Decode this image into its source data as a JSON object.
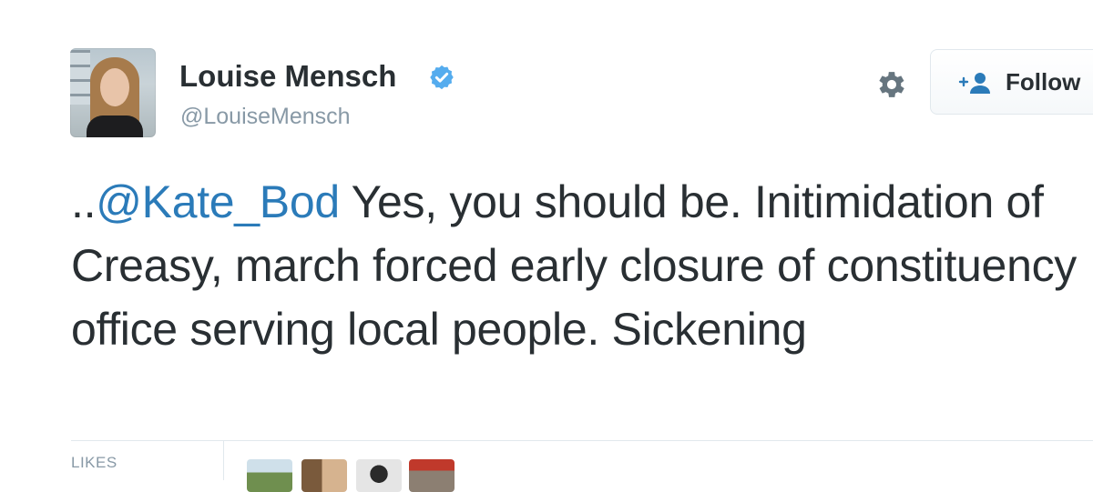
{
  "user": {
    "name": "Louise Mensch",
    "handle": "@LouiseMensch",
    "verified": true,
    "avatar_icon": "profile-photo"
  },
  "actions": {
    "settings_icon": "gear-icon",
    "follow_label": "Follow",
    "follow_icon": "add-person-icon"
  },
  "tweet": {
    "prefix": "..",
    "mention": "@Kate_Bod",
    "text": " Yes, you should be. Initimidation of Creasy, march forced early closure of constituency office serving local people. Sickening"
  },
  "stats": {
    "likes_label": "LIKES",
    "likers": [
      "liker-avatar-1",
      "liker-avatar-2",
      "liker-avatar-3",
      "liker-avatar-4"
    ]
  },
  "colors": {
    "text": "#292f33",
    "secondary": "#8899a6",
    "link": "#2b7bb9",
    "verified": "#55acee",
    "border": "#e1e8ed"
  }
}
